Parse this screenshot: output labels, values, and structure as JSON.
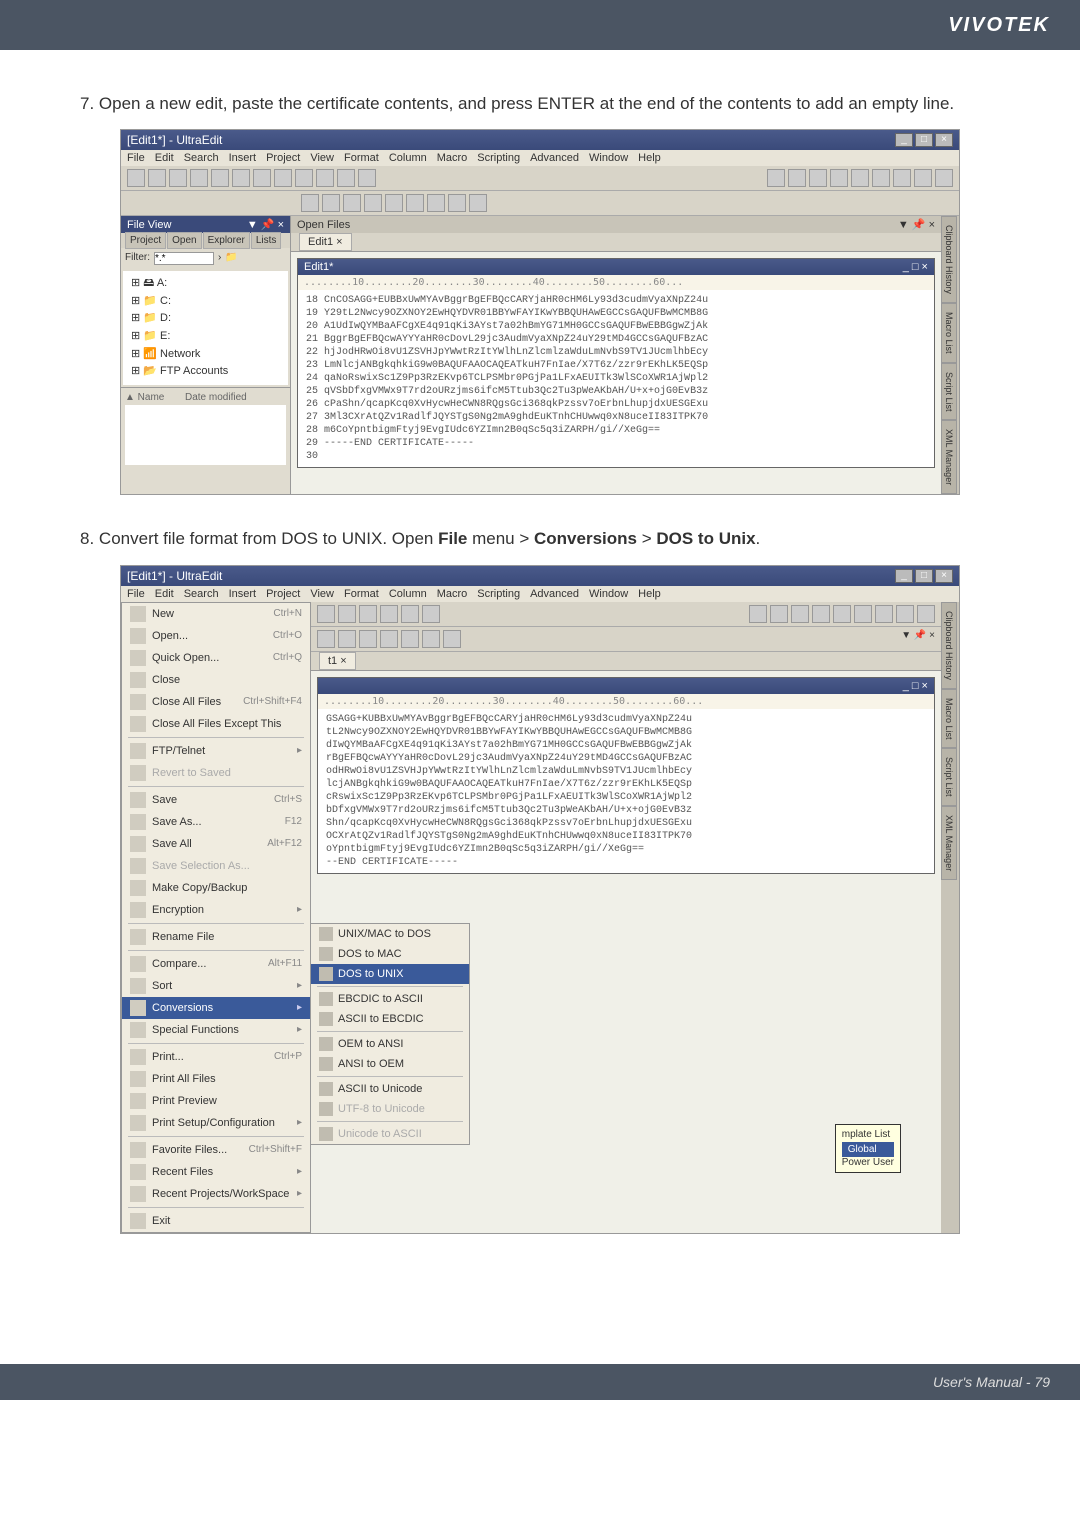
{
  "header": {
    "brand": "VIVOTEK"
  },
  "steps": {
    "s7": {
      "num": "7.",
      "text": "Open a new edit, paste the certificate contents, and press ENTER at the end of the contents to add an empty line."
    },
    "s8": {
      "num": "8.",
      "text_prefix": "Convert file format from DOS to UNIX. Open ",
      "file": "File",
      "mid1": " menu > ",
      "conversions": "Conversions",
      "mid2": " > ",
      "dos": "DOS to Unix",
      "end": "."
    }
  },
  "ss1": {
    "title": "[Edit1*] - UltraEdit",
    "menus": [
      "File",
      "Edit",
      "Search",
      "Insert",
      "Project",
      "View",
      "Format",
      "Column",
      "Macro",
      "Scripting",
      "Advanced",
      "Window",
      "Help"
    ],
    "fileview": "File View",
    "tabs": [
      "Project",
      "Open",
      "Explorer",
      "Lists"
    ],
    "filter_label": "Filter:",
    "filter_value": "*.*",
    "tree": [
      "⊞ 🖴 A:",
      "⊞ 📁 C:",
      "⊞ 📁 D:",
      "⊞ 📁 E:",
      "⊞ 📶 Network",
      "⊞ 📂 FTP Accounts"
    ],
    "date_header": [
      "▲ Name",
      "Date modified"
    ],
    "open_files": "Open Files",
    "edit_tab": "Edit1  ×",
    "doc_title": "Edit1*",
    "ruler": "........10........20........30........40........50........60...",
    "cert_lines": [
      "18 CnCOSAGG+EUBBxUwMYAvBggrBgEFBQcCARYjaHR0cHM6Ly93d3cudmVyaXNpZ24u",
      "19 Y29tL2Nwcy9OZXNOY2EwHQYDVR01BBYwFAYIKwYBBQUHAwEGCCsGAQUFBwMCMB8G",
      "20 A1UdIwQYMBaAFCgXE4q91qKi3AYst7a02hBmYG71MH0GCCsGAQUFBwEBBGgwZjAk",
      "21 BggrBgEFBQcwAYYYaHR0cDovL29jc3AudmVyaXNpZ24uY29tMD4GCCsGAQUFBzAC",
      "22 hjJodHRwOi8vU1ZSVHJpYWwtRzItYWlhLnZlcmlzaWduLmNvbS9TV1JUcmlhbEcy",
      "23 LmNlcjANBgkqhkiG9w0BAQUFAAOCAQEATkuH7FnIae/X7T6z/zzr9rEKhLK5EQSp",
      "24 qaNoRswixSc1Z9Pp3RzEKvp6TCLPSMbr0PGjPa1LFxAEUITk3WlSCoXWR1AjWpl2",
      "25 qVSbDfxgVMWx9T7rd2oURzjms6ifcM5Ttub3Qc2Tu3pWeAKbAH/U+x+ojG0EvB3z",
      "26 cPaShn/qcapKcq0XvHycwHeCWN8RQgsGci368qkPzssv7oErbnLhupjdxUESGExu",
      "27 3Ml3CXrAtQZv1RadlfJQYSTgS0Ng2mA9ghdEuKTnhCHUwwq0xN8uceII83ITPK70",
      "28 m6CoYpntbigmFtyj9EvgIUdc6YZImn2B0qSc5q3iZARPH/gi//XeGg==",
      "29 -----END CERTIFICATE-----",
      "30 "
    ],
    "sidepanels": [
      "Clipboard History",
      "Macro List",
      "Script List",
      "XML Manager"
    ]
  },
  "ss2": {
    "title": "[Edit1*] - UltraEdit",
    "menus": [
      "File",
      "Edit",
      "Search",
      "Insert",
      "Project",
      "View",
      "Format",
      "Column",
      "Macro",
      "Scripting",
      "Advanced",
      "Window",
      "Help"
    ],
    "filemenu": [
      {
        "label": "New",
        "sc": "Ctrl+N"
      },
      {
        "label": "Open...",
        "sc": "Ctrl+O"
      },
      {
        "label": "Quick Open...",
        "sc": "Ctrl+Q"
      },
      {
        "label": "Close",
        "sc": ""
      },
      {
        "label": "Close All Files",
        "sc": "Ctrl+Shift+F4"
      },
      {
        "label": "Close All Files Except This",
        "sc": ""
      },
      {
        "sep": true
      },
      {
        "label": "FTP/Telnet",
        "sc": "",
        "arrow": true
      },
      {
        "label": "Revert to Saved",
        "sc": "",
        "dim": true
      },
      {
        "sep": true
      },
      {
        "label": "Save",
        "sc": "Ctrl+S"
      },
      {
        "label": "Save As...",
        "sc": "F12"
      },
      {
        "label": "Save All",
        "sc": "Alt+F12"
      },
      {
        "label": "Save Selection As...",
        "sc": "",
        "dim": true
      },
      {
        "label": "Make Copy/Backup",
        "sc": ""
      },
      {
        "label": "Encryption",
        "sc": "",
        "arrow": true
      },
      {
        "sep": true
      },
      {
        "label": "Rename File",
        "sc": ""
      },
      {
        "sep": true
      },
      {
        "label": "Compare...",
        "sc": "Alt+F11"
      },
      {
        "label": "Sort",
        "sc": "",
        "arrow": true
      },
      {
        "label": "Conversions",
        "sc": "",
        "arrow": true,
        "hl": true
      },
      {
        "label": "Special Functions",
        "sc": "",
        "arrow": true
      },
      {
        "sep": true
      },
      {
        "label": "Print...",
        "sc": "Ctrl+P"
      },
      {
        "label": "Print All Files",
        "sc": ""
      },
      {
        "label": "Print Preview",
        "sc": ""
      },
      {
        "label": "Print Setup/Configuration",
        "sc": "",
        "arrow": true
      },
      {
        "sep": true
      },
      {
        "label": "Favorite Files...",
        "sc": "Ctrl+Shift+F"
      },
      {
        "label": "Recent Files",
        "sc": "",
        "arrow": true
      },
      {
        "label": "Recent Projects/WorkSpace",
        "sc": "",
        "arrow": true
      },
      {
        "sep": true
      },
      {
        "label": "Exit",
        "sc": ""
      }
    ],
    "conversions_submenu": [
      {
        "label": "UNIX/MAC to DOS"
      },
      {
        "label": "DOS to MAC"
      },
      {
        "label": "DOS to UNIX",
        "hl": true
      },
      {
        "sep": true
      },
      {
        "label": "EBCDIC to ASCII"
      },
      {
        "label": "ASCII to EBCDIC"
      },
      {
        "sep": true
      },
      {
        "label": "OEM to ANSI"
      },
      {
        "label": "ANSI to OEM"
      },
      {
        "sep": true
      },
      {
        "label": "ASCII to Unicode"
      },
      {
        "label": "UTF-8 to Unicode",
        "dim": true
      },
      {
        "sep": true
      },
      {
        "label": "Unicode to ASCII",
        "dim": true
      }
    ],
    "edit_tab": "t1  ×",
    "ruler": "........10........20........30........40........50........60...",
    "cert_lines": [
      "GSAGG+KUBBxUwMYAvBggrBgEFBQcCARYjaHR0cHM6Ly93d3cudmVyaXNpZ24u",
      "tL2Nwcy9OZXNOY2EwHQYDVR01BBYwFAYIKwYBBQUHAwEGCCsGAQUFBwMCMB8G",
      "dIwQYMBaAFCgXE4q91qKi3AYst7a02hBmYG71MH0GCCsGAQUFBwEBBGgwZjAk",
      "rBgEFBQcwAYYYaHR0cDovL29jc3AudmVyaXNpZ24uY29tMD4GCCsGAQUFBzAC",
      "odHRwOi8vU1ZSVHJpYWwtRzItYWlhLnZlcmlzaWduLmNvbS9TV1JUcmlhbEcy",
      "lcjANBgkqhkiG9w0BAQUFAAOCAQEATkuH7FnIae/X7T6z/zzr9rEKhLK5EQSp",
      "cRswixSc1Z9Pp3RzEKvp6TCLPSMbr0PGjPa1LFxAEUITk3WlSCoXWR1AjWpl2",
      "bDfxgVMWx9T7rd2oURzjms6ifcM5Ttub3Qc2Tu3pWeAKbAH/U+x+ojG0EvB3z",
      "Shn/qcapKcq0XvHycwHeCWN8RQgsGci368qkPzssv7oErbnLhupjdxUESGExu",
      "OCXrAtQZv1RadlfJQYSTgS0Ng2mA9ghdEuKTnhCHUwwq0xN8uceII83ITPK70",
      "oYpntbigmFtyj9EvgIUdc6YZImn2B0qSc5q3iZARPH/gi//XeGg==",
      "--END CERTIFICATE-----"
    ],
    "tooltip": {
      "header": "mplate List",
      "line1": "Global",
      "line2": "Power User"
    }
  },
  "footer": {
    "text": "User's Manual - 79"
  }
}
